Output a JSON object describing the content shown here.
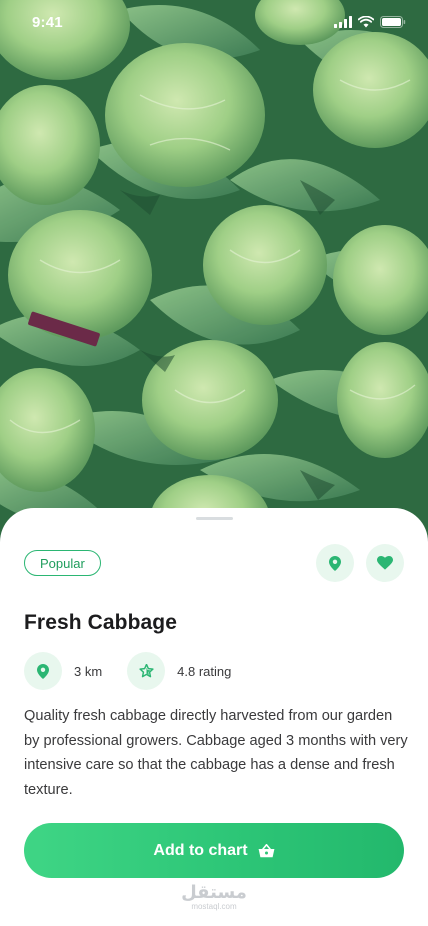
{
  "status_bar": {
    "time": "9:41"
  },
  "product": {
    "badge": "Popular",
    "title": "Fresh Cabbage",
    "distance": "3 km",
    "rating": "4.8 rating",
    "description": "Quality fresh cabbage directly harvested from our garden by professional growers. Cabbage aged 3 months with very intensive care so that the cabbage has a dense and fresh texture."
  },
  "actions": {
    "add_to_cart_label": "Add to chart"
  },
  "watermark": {
    "main": "مستقل",
    "sub": "mostaql.com"
  },
  "icons": {
    "location": "map-pin-icon",
    "favorite": "heart-icon",
    "rating": "star-icon",
    "cart": "shopping-basket-icon"
  },
  "colors": {
    "accent": "#2bb673",
    "accent_light": "#e8f7ee",
    "cta_start": "#3fd585",
    "cta_end": "#23b86c"
  }
}
